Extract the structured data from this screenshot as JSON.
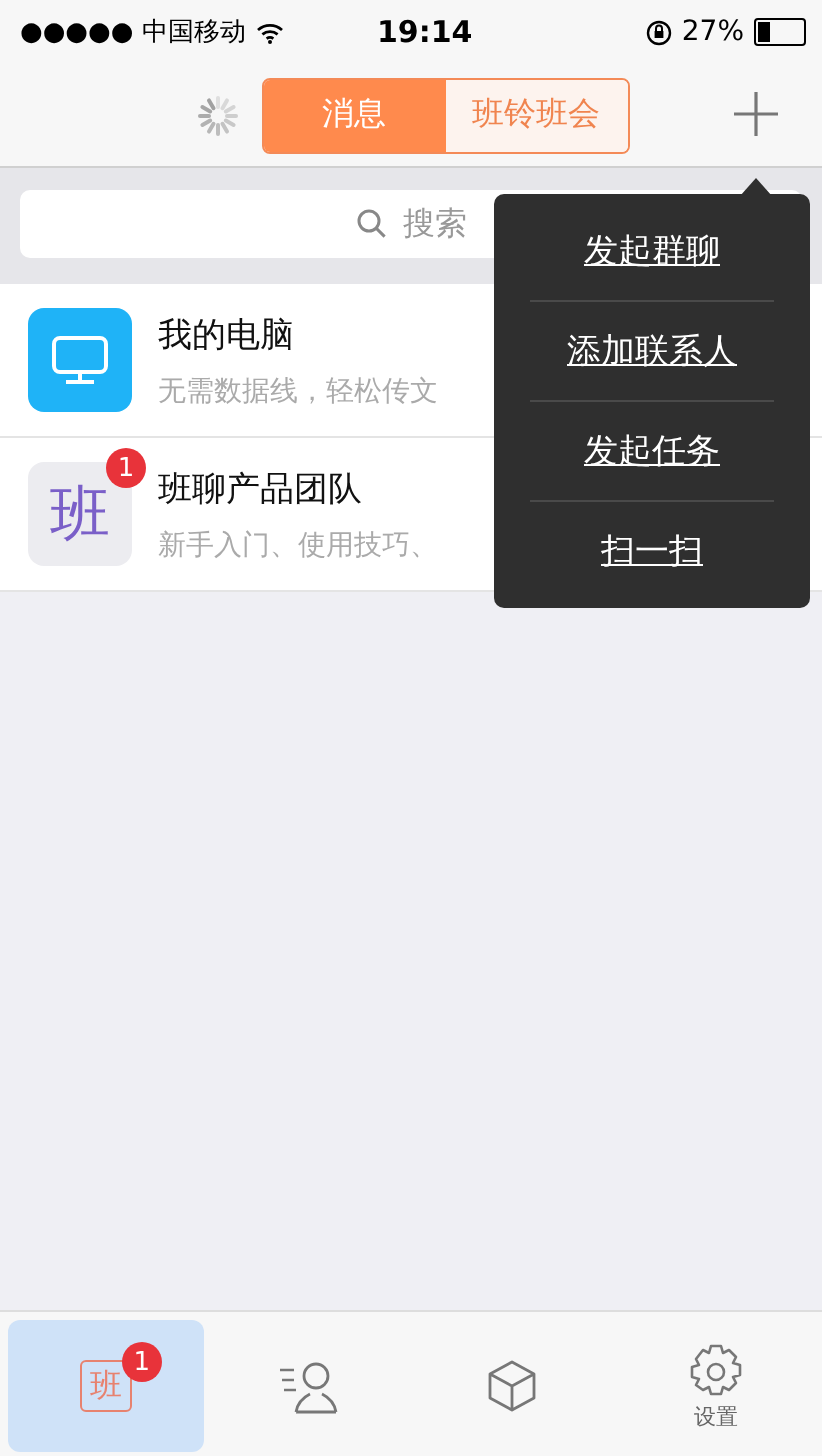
{
  "status_bar": {
    "carrier": "●●●●● 中国移动",
    "time": "19:14",
    "battery": "27%"
  },
  "nav": {
    "segments": [
      {
        "label": "消息",
        "selected": true
      },
      {
        "label": "班铃班会",
        "selected": false
      }
    ],
    "loading": true
  },
  "search": {
    "placeholder": "搜索"
  },
  "conversations": [
    {
      "kind": "computer",
      "name": "我的电脑",
      "preview": "无需数据线，轻松传文"
    },
    {
      "kind": "team",
      "avatar_text": "班",
      "badge": "1",
      "name": "班聊产品团队",
      "preview": "新手入门、使用技巧、"
    }
  ],
  "menu": {
    "items": [
      "发起群聊",
      "添加联系人",
      "发起任务",
      "扫一扫"
    ]
  },
  "tab_bar": [
    {
      "kind": "home",
      "avatar_text": "班",
      "badge": "1",
      "selected": true
    },
    {
      "kind": "contacts",
      "selected": false
    },
    {
      "kind": "apps",
      "selected": false
    },
    {
      "kind": "settings",
      "label": "设置",
      "selected": false
    }
  ]
}
